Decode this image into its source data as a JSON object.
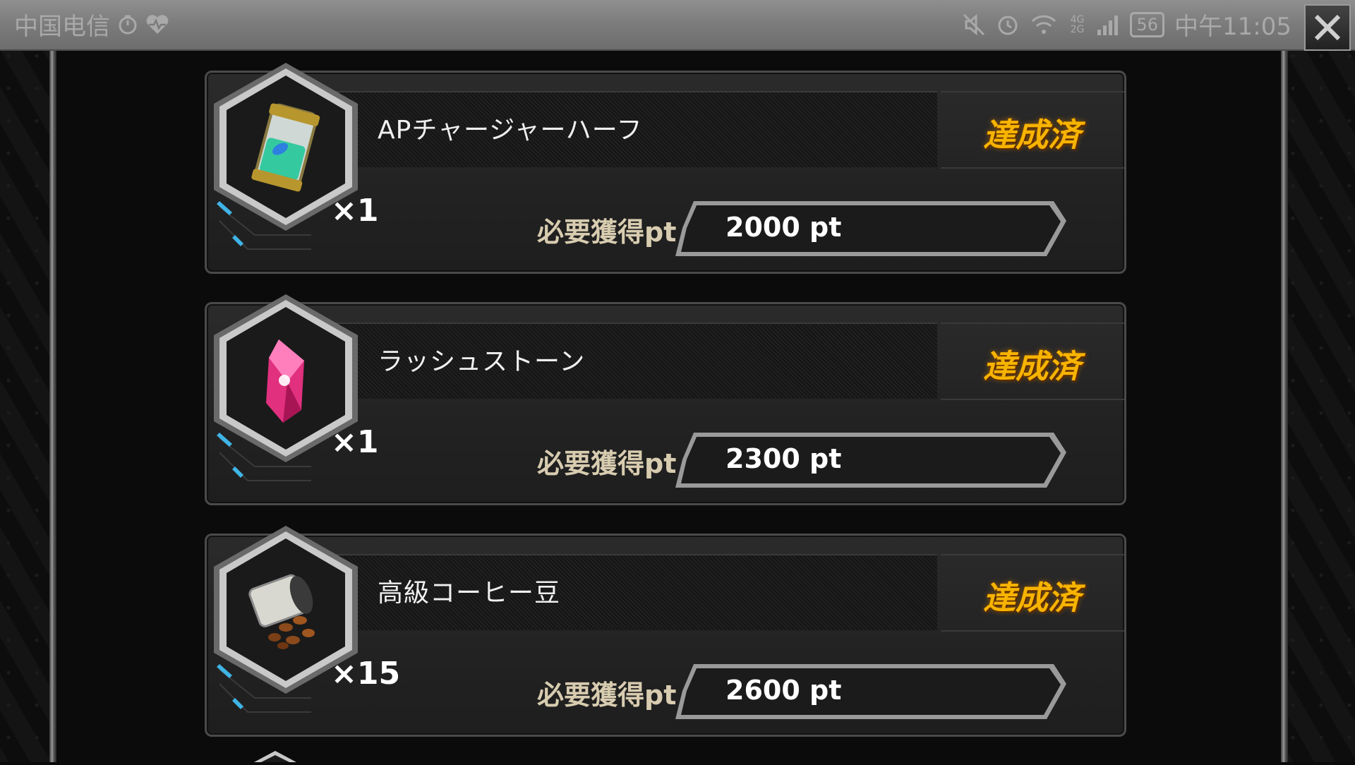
{
  "status_bar": {
    "carrier": "中国电信",
    "time": "中午11:05",
    "battery": "56",
    "network": "4G 2G"
  },
  "labels": {
    "required_points": "必要獲得pt",
    "achieved": "達成済"
  },
  "rewards": [
    {
      "name": "APチャージャーハーフ",
      "quantity": "×1",
      "required_pt": "2000 pt",
      "status": "達成済",
      "icon": "ap-charger-icon"
    },
    {
      "name": "ラッシュストーン",
      "quantity": "×1",
      "required_pt": "2300 pt",
      "status": "達成済",
      "icon": "rush-stone-icon"
    },
    {
      "name": "高級コーヒー豆",
      "quantity": "×15",
      "required_pt": "2600 pt",
      "status": "達成済",
      "icon": "coffee-beans-icon"
    }
  ],
  "colors": {
    "achieved": "#f7b400",
    "label": "#d8ccb0",
    "panel": "#222222"
  }
}
